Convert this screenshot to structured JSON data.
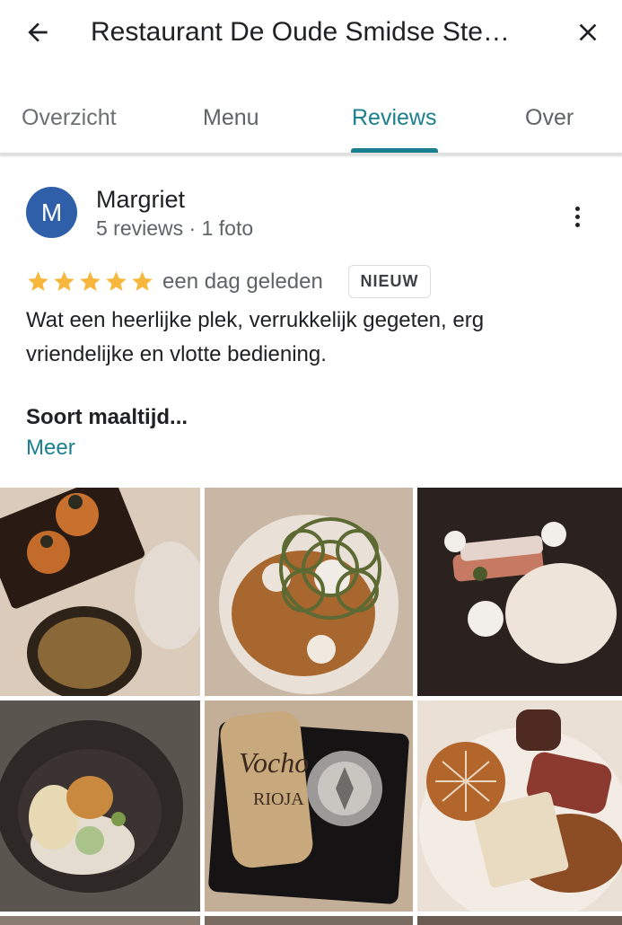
{
  "header": {
    "title": "Restaurant De Oude Smidse Ste…",
    "back_icon": "arrow-left-icon",
    "close_icon": "close-icon"
  },
  "tabs": [
    {
      "label": "Overzicht"
    },
    {
      "label": "Menu"
    },
    {
      "label": "Reviews",
      "active": true
    },
    {
      "label": "Over"
    }
  ],
  "review": {
    "avatar_letter": "M",
    "avatar_color": "#2e5fa8",
    "reviewer_name": "Margriet",
    "reviewer_meta": "5 reviews · 1 foto",
    "rating": 5,
    "date": "een dag geleden",
    "badge": "NIEUW",
    "text": "Wat een heerlijke plek, verrukkelijk gegeten, erg vriendelijke en vlotte bediening.",
    "subheading": "Soort maaltijd...",
    "more_link": "Meer"
  },
  "colors": {
    "accent": "#1a7f8e",
    "star": "#f6b73c"
  }
}
